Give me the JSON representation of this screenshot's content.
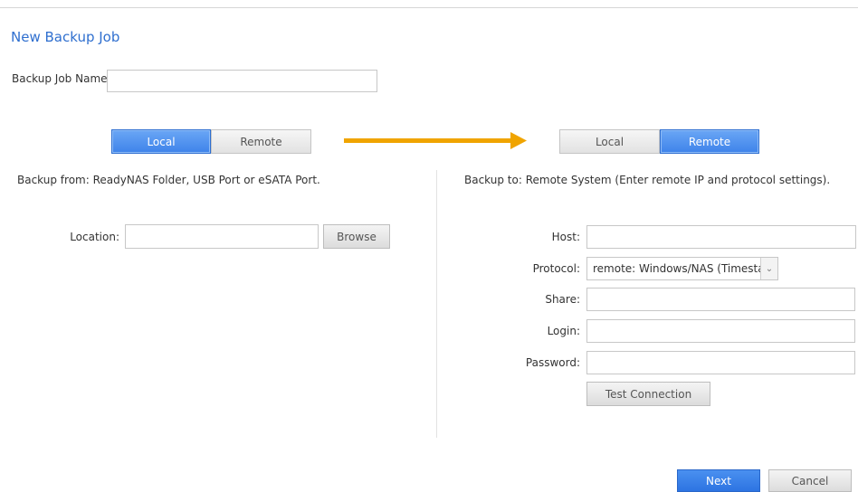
{
  "title": "New Backup Job",
  "job_name": {
    "label": "Backup Job Name:",
    "value": ""
  },
  "source": {
    "toggle": {
      "local": "Local",
      "remote": "Remote",
      "selected": "Local"
    },
    "description": "Backup from: ReadyNAS Folder, USB Port or eSATA Port.",
    "location_label": "Location:",
    "location_value": "",
    "browse_label": "Browse"
  },
  "destination": {
    "toggle": {
      "local": "Local",
      "remote": "Remote",
      "selected": "Remote"
    },
    "description": "Backup to: Remote System (Enter remote IP and protocol settings).",
    "host_label": "Host:",
    "host_value": "",
    "protocol_label": "Protocol:",
    "protocol_value": "remote: Windows/NAS (Timestamp)",
    "share_label": "Share:",
    "share_value": "",
    "login_label": "Login:",
    "login_value": "",
    "password_label": "Password:",
    "password_value": "",
    "test_connection_label": "Test Connection"
  },
  "footer": {
    "next_label": "Next",
    "cancel_label": "Cancel"
  },
  "colors": {
    "accent": "#3e83ea",
    "arrow": "#f0a400",
    "title": "#2f6fcf"
  },
  "icons": {
    "direction_arrow": "arrow-right-icon",
    "dropdown": "chevron-down-icon"
  }
}
